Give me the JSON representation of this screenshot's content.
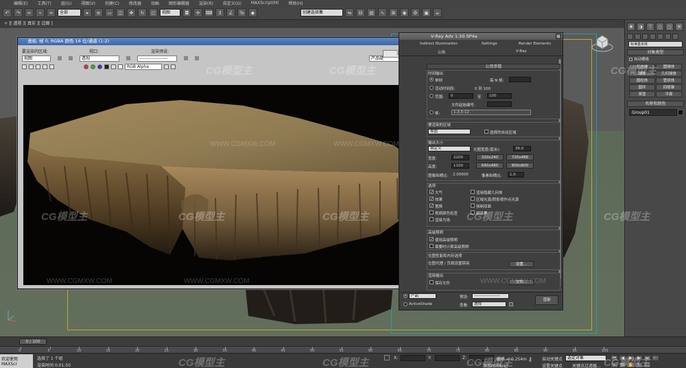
{
  "menu": [
    "编辑(E)",
    "工具(T)",
    "组(G)",
    "视图(V)",
    "创建(C)",
    "修改器",
    "动画",
    "图形编辑器",
    "渲染(R)",
    "自定义(U)",
    "MAXScript(M)",
    "帮助(H)"
  ],
  "toolbar": {
    "filter_select": "全部",
    "ref_coord_select": "视图",
    "named_sel_select": "创建选择集"
  },
  "viewport": {
    "label": "+ ][ 透视 ][ 真实 ][ 边面 ]",
    "frame_color": "#b6b22a",
    "safe_color": "#2c9aa8"
  },
  "command_panel": {
    "category_select": "标准基本体",
    "object_type_label": "对象类型",
    "auto_grid": "自动栅格",
    "buttons": [
      "长方体",
      "圆锥体",
      "球体",
      "几何球体",
      "圆柱体",
      "管状体",
      "圆环",
      "四棱锥",
      "茶壶",
      "平面"
    ],
    "name_color_label": "名称和颜色",
    "object_name": "Group01"
  },
  "frame_buffer": {
    "title": "透视, 帧 0, RGBA 颜色 16 位/通道 (1:2)",
    "area_label": "要渲染的区域:",
    "area_value": "视图",
    "viewport_label": "视口:",
    "viewport_value": "透视",
    "preset_label": "渲染预设:",
    "preset_value": "-------------------",
    "render_button": "渲染",
    "product_value": "产品级",
    "channel_value": "RGB Alpha"
  },
  "vray": {
    "title": "V-Ray Adv 1.50.SP4a",
    "tabs_top": [
      "Indirect Illumination",
      "Settings",
      "Render Elements"
    ],
    "tabs_bottom": [
      "公用",
      "V-Ray"
    ],
    "common_params": "公用参数",
    "time_output": "时间输出",
    "single": "单帧",
    "every_n": "每 N 帧:",
    "active_segment": "活动时间段:",
    "active_range": "0 到 100",
    "range": "范围:",
    "range_from": "0",
    "range_to_label": "至",
    "range_to": "100",
    "file_number_base": "文件起始编号:",
    "frames": "帧:",
    "frames_value": "1,3,5-12",
    "area_group": "要渲染的区域",
    "area_value": "视图",
    "auto_region": "选择的自动区域",
    "output_size": "输出大小",
    "custom": "自定义",
    "aperture_label": "光圈宽度(毫米):",
    "aperture_value": "36.0",
    "width_label": "宽度:",
    "width_value": "2200",
    "height_label": "高度:",
    "height_value": "1100",
    "presets": [
      "320x240",
      "720x486",
      "640x480",
      "800x600"
    ],
    "aspect_label": "图像纵横比:",
    "aspect_value": "2.00000",
    "pixel_aspect_label": "像素纵横比:",
    "pixel_aspect_value": "1.0",
    "options": "选项",
    "opts_left": [
      "大气",
      "效果",
      "置换",
      "视频颜色检查",
      "渲染为场"
    ],
    "opts_left_checked": [
      true,
      true,
      true,
      false,
      false
    ],
    "opts_right": [
      "渲染隐藏几何体",
      "区域光源/阴影视作点光源",
      "强制双面",
      "超级黑"
    ],
    "adv_lighting": "高级照明",
    "use_adv_lighting": "使用高级照明",
    "compute_adv_lighting": "需要时计算高级照明",
    "bitmap_perf": "位图性能和内存选项",
    "bitmap_proxy": "位图代理 / 页面设置禁用",
    "setup_button": "设置...",
    "render_output": "渲染输出",
    "save_file": "保存文件",
    "files_button": "文件...",
    "production": "产品",
    "activeshade": "ActiveShade",
    "preset_label": "预设:",
    "preset_value": "-------------------",
    "view_label": "查看:",
    "view_value": "透视",
    "render_button": "渲染"
  },
  "timeline": {
    "frame": "0 / 100",
    "ticks": [
      "0",
      "5",
      "10",
      "15",
      "20",
      "25",
      "30",
      "35",
      "40",
      "45",
      "50",
      "55",
      "60",
      "65",
      "70",
      "75",
      "80",
      "85",
      "90",
      "95",
      "100"
    ]
  },
  "status": {
    "user": "欢迎使用 MAXScr",
    "selected": "选择了 1 个组",
    "hint": "渲染时间 0:01:50",
    "x_label": "X:",
    "y_label": "Y:",
    "z_label": "Z:",
    "grid": "栅格 = 0.254m",
    "autokey": "自动关键点",
    "autokey_select": "选定对象",
    "setkey": "设置关键点",
    "keyfilter": "关键点过滤器...",
    "add_time_tag": "添加时间标记"
  },
  "watermark": {
    "brand": "CG模型主",
    "url": "WWW.CGMXW.COM"
  }
}
